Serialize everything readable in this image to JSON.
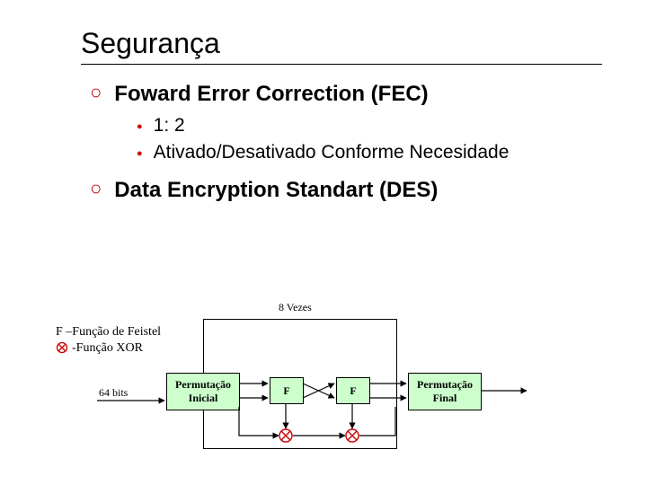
{
  "title": "Segurança",
  "fec": {
    "heading": "Foward Error Correction (FEC)",
    "items": [
      "1: 2",
      "Ativado/Desativado Conforme Necesidade"
    ]
  },
  "des": {
    "heading": "Data Encryption Standart (DES)"
  },
  "diagram": {
    "rounds_caption": "8 Vezes",
    "legend_f": "F –Função de Feistel",
    "legend_xor": "-Função XOR",
    "bits_label": "64 bits",
    "box_pi": "Permutação Inicial",
    "box_f1": "F",
    "box_f2": "F",
    "box_pf": "Permutação Final"
  }
}
